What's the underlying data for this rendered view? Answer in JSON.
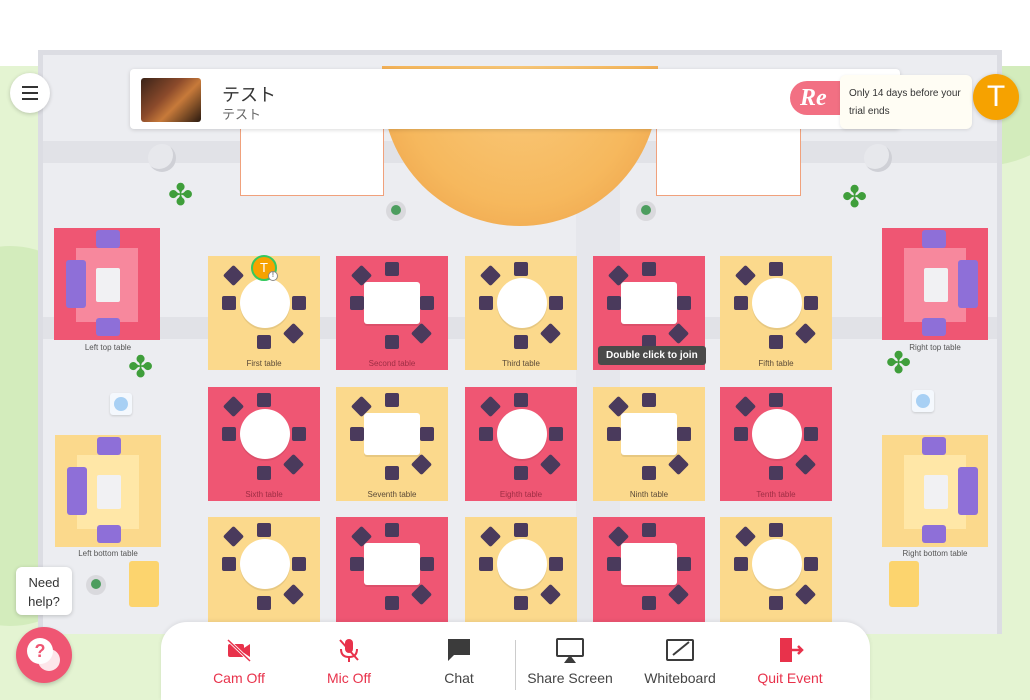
{
  "header": {
    "event_title": "テスト",
    "event_subtitle": "テスト",
    "brand_text": "Re",
    "trial_notice": "Only 14 days before your trial ends",
    "user_initial": "T"
  },
  "tables": [
    {
      "label": "First table",
      "color": "yellow",
      "shape": "round"
    },
    {
      "label": "Second table",
      "color": "pink",
      "shape": "square"
    },
    {
      "label": "Third table",
      "color": "yellow",
      "shape": "round"
    },
    {
      "label": "",
      "color": "pink",
      "shape": "square"
    },
    {
      "label": "Fifth table",
      "color": "yellow",
      "shape": "round"
    },
    {
      "label": "Sixth table",
      "color": "pink",
      "shape": "round"
    },
    {
      "label": "Seventh table",
      "color": "yellow",
      "shape": "square"
    },
    {
      "label": "Eighth table",
      "color": "pink",
      "shape": "round"
    },
    {
      "label": "Ninth table",
      "color": "yellow",
      "shape": "square"
    },
    {
      "label": "Tenth table",
      "color": "pink",
      "shape": "round"
    },
    {
      "label": "",
      "color": "yellow",
      "shape": "round"
    },
    {
      "label": "",
      "color": "pink",
      "shape": "square"
    },
    {
      "label": "",
      "color": "yellow",
      "shape": "round"
    },
    {
      "label": "",
      "color": "pink",
      "shape": "square"
    },
    {
      "label": "",
      "color": "yellow",
      "shape": "round"
    }
  ],
  "side_tables": {
    "left_top": "Left top table",
    "right_top": "Right top table",
    "left_bottom": "Left bottom table",
    "right_bottom": "Right bottom table"
  },
  "tooltip": "Double click to join",
  "presence": {
    "initial": "T",
    "badge": "!"
  },
  "controls": {
    "cam": "Cam Off",
    "mic": "Mic Off",
    "chat": "Chat",
    "share": "Share Screen",
    "whiteboard": "Whiteboard",
    "quit": "Quit Event"
  },
  "help": {
    "bubble": "Need help?",
    "icon": "?"
  },
  "colors": {
    "accent": "#e8324b",
    "pink": "#ef5673",
    "yellow": "#fbd98c",
    "avatar": "#f6a200"
  }
}
